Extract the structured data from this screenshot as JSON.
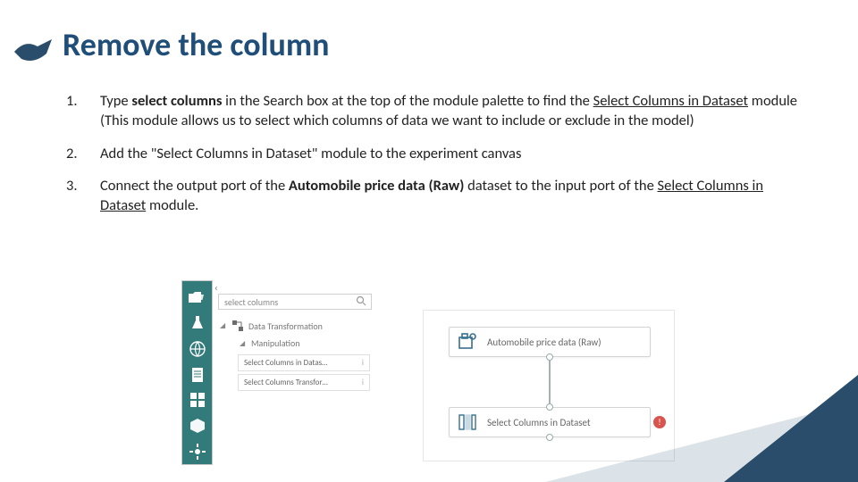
{
  "title": "Remove the column",
  "steps": {
    "s1_a": "Type ",
    "s1_b": "select columns",
    "s1_c": " in the Search box at the top of the module palette to find the ",
    "s1_d": "Select Columns in Dataset",
    "s1_e": " module (This module allows us to select which columns of data we want to include or exclude in the model)",
    "s2": "Add the \"Select Columns in Dataset\" module to the experiment canvas",
    "s3_a": "Connect the output port of the ",
    "s3_b": "Automobile price data (Raw)",
    "s3_c": " dataset to the input port of the ",
    "s3_d": "Select Columns in Dataset",
    "s3_e": " module."
  },
  "palette": {
    "search_value": "select columns",
    "group": "Data Transformation",
    "subgroup": "Manipulation",
    "items": [
      "Select Columns in Datas…",
      "Select Columns Transfor…"
    ],
    "info_glyph": "i"
  },
  "canvas": {
    "node1": "Automobile price data (Raw)",
    "node2": "Select Columns in Dataset",
    "warn_glyph": "!"
  }
}
